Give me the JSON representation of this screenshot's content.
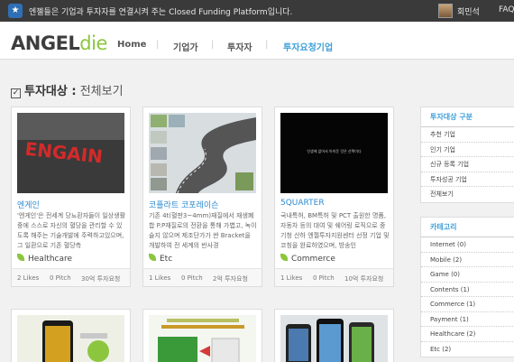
{
  "topbar": {
    "notice": "엔젤들은 기업과 투자자를 연결시켜 주는 Closed Funding Platform입니다.",
    "user": "회민석",
    "faq": "FAQ"
  },
  "header": {
    "logo_main": "ANGEL",
    "logo_accent": "die",
    "nav": [
      "Home",
      "기업가",
      "투자자",
      "투자요청기업"
    ]
  },
  "page": {
    "title_label": "투자대상 :",
    "title_sub": "전체보기"
  },
  "cards": [
    {
      "title": "엔게인",
      "desc": "'엔게인'은 전세계 당뇨환자들이 일상생활 중에 스스로 자신의 혈당을 관리할 수 있도록 해주는 기술개발에 주력하고있으며, 그 일환으로 기존 혈당측",
      "category": "Healthcare",
      "likes": "2 Likes",
      "pitch": "0 Pitch",
      "request": "30억 투자요청"
    },
    {
      "title": "코플라트 코포레이슨",
      "desc": "기존 4t(혈판3~4mm)재질에서 재생폐합 P.P재질로의 전환을 통해 가볍고, 녹이 슬지 않으며 제조단가가 싼 Bracket을 개발하여 전 세계의 반사경",
      "category": "Etc",
      "likes": "1 Likes",
      "pitch": "0 Pitch",
      "request": "2억 투자요청"
    },
    {
      "title": "5QUARTER",
      "desc": "국내특허, BM특허 및 PCT 출원한 명품, 자동차 등의 대여 및 쉐어링 로직으로 중기청 산하 엔젤투자지원센터 선정 기업 및 코칭을 완료하였으며, 방송인",
      "category": "Commerce",
      "likes": "1 Likes",
      "pitch": "0 Pitch",
      "request": "10억 투자요청"
    }
  ],
  "card2_overlay": "인생에 없어서 아쉬운 것은 선택이다",
  "sidebar": {
    "section1_title": "투자대상 구분",
    "section1_items": [
      "추천 기업",
      "인기 기업",
      "신규 등록 기업",
      "투자성공 기업",
      "전체보기"
    ],
    "section2_title": "카테고리",
    "section2_items": [
      "Internet (0)",
      "Mobile (2)",
      "Game (0)",
      "Contents (1)",
      "Commerce (1)",
      "Payment (1)",
      "Healthcare (2)",
      "Etc (2)"
    ]
  }
}
